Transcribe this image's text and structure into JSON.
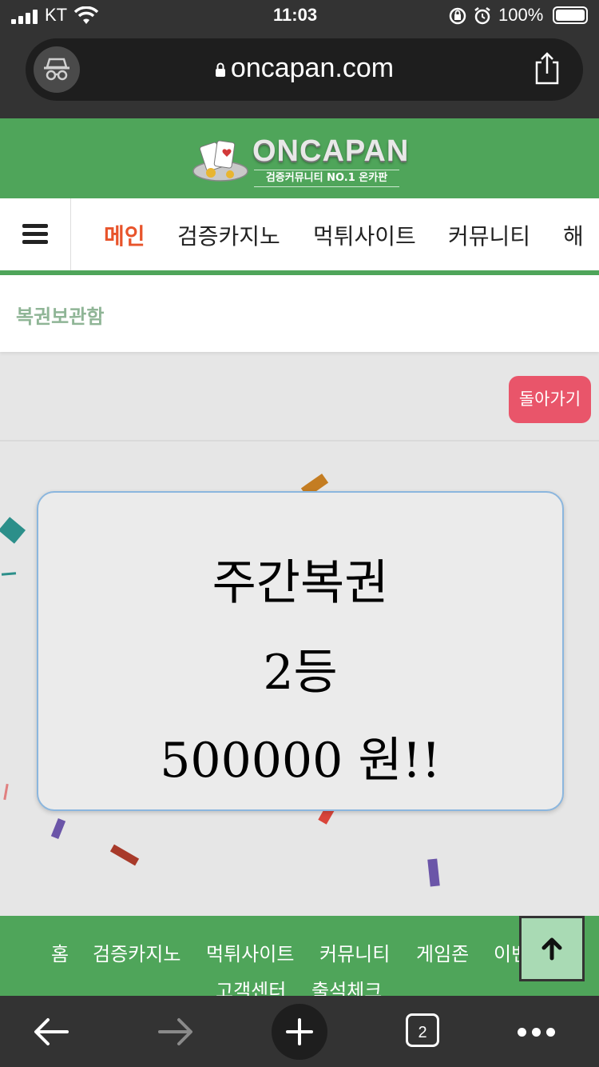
{
  "status_bar": {
    "carrier": "KT",
    "time": "11:03",
    "battery": "100%"
  },
  "browser": {
    "url": "oncapan.com",
    "tab_count": "2"
  },
  "site": {
    "brand": "ONCAPAN",
    "tagline": "검증커뮤니티 NO.1 온카판",
    "accent_color": "#4fa55a"
  },
  "nav": {
    "items": [
      {
        "label": "메인"
      },
      {
        "label": "검증카지노"
      },
      {
        "label": "먹튀사이트"
      },
      {
        "label": "커뮤니티"
      },
      {
        "label": "해"
      }
    ]
  },
  "page": {
    "title": "복권보관함",
    "back_label": "돌아가기"
  },
  "lottery": {
    "type": "주간복권",
    "rank": "2등",
    "prize": "500000 원!!"
  },
  "footer": {
    "links": [
      {
        "label": "홈"
      },
      {
        "label": "검증카지노"
      },
      {
        "label": "먹튀사이트"
      },
      {
        "label": "커뮤니티"
      },
      {
        "label": "게임존"
      },
      {
        "label": "이벤트"
      },
      {
        "label": "고객센터"
      },
      {
        "label": "출석체크"
      }
    ]
  },
  "icons": {
    "hamburger": "menu-icon",
    "scroll_top": "arrow-up-icon",
    "incognito": "incognito-icon",
    "share": "share-icon"
  }
}
